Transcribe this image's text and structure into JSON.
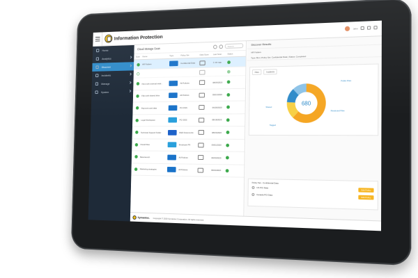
{
  "app": {
    "title": "Information Protection",
    "user_label": "John"
  },
  "sidebar": {
    "items": [
      {
        "label": "Home",
        "active": false,
        "chevron": false
      },
      {
        "label": "Analytics",
        "active": false,
        "chevron": true
      },
      {
        "label": "Discover",
        "active": true,
        "chevron": true
      },
      {
        "label": "Incidents",
        "active": false,
        "chevron": true
      },
      {
        "label": "Manage",
        "active": false,
        "chevron": true
      },
      {
        "label": "System",
        "active": false,
        "chevron": true
      }
    ]
  },
  "main": {
    "header": "Cloud Storage Scan",
    "search_placeholder": "Search",
    "columns": [
      "Scan",
      "Name",
      "Type",
      "Policy Set",
      "Data Scan",
      "Last Scan",
      "Status"
    ],
    "rows": [
      {
        "state": "selected",
        "scan": "full",
        "name": "HR Folders",
        "type": "box",
        "type_color": "#1a73c9",
        "policy": "Confidential Data",
        "last": "1 min ago"
      },
      {
        "state": "faded",
        "scan": "empty",
        "name": "",
        "type": "",
        "type_color": "#ffffff",
        "policy": "",
        "last": ""
      },
      {
        "state": "normal",
        "scan": "full",
        "name": "Files with external relati...",
        "type": "box",
        "type_color": "#1a73c9",
        "policy": "All Policies",
        "last": "08/05/2020"
      },
      {
        "state": "normal",
        "scan": "full",
        "name": "Files with shared links",
        "type": "box",
        "type_color": "#1a73c9",
        "policy": "All Policies",
        "last": "09/01/2020"
      },
      {
        "state": "normal",
        "scan": "full",
        "name": "Payment card data",
        "type": "box",
        "type_color": "#1a73c9",
        "policy": "PCI DSS",
        "last": "06/29/2020"
      },
      {
        "state": "normal",
        "scan": "full",
        "name": "Legal Workspace",
        "type": "sf",
        "type_color": "#2aa0dc",
        "policy": "PCI DSS",
        "last": "08/18/2020"
      },
      {
        "state": "normal",
        "scan": "full",
        "name": "Technical Support Folder",
        "type": "db",
        "type_color": "#1e62c9",
        "policy": "R&D Documents",
        "last": "08/03/2020"
      },
      {
        "state": "normal",
        "scan": "full",
        "name": "Fiscal Files",
        "type": "sf",
        "type_color": "#2aa0dc",
        "policy": "Employee PII",
        "last": "09/01/2020"
      },
      {
        "state": "normal",
        "scan": "full",
        "name": "Beta launch",
        "type": "box",
        "type_color": "#1a73c9",
        "policy": "All Policies",
        "last": "09/03/2020"
      },
      {
        "state": "normal",
        "scan": "full",
        "name": "Marketing strategies",
        "type": "box",
        "type_color": "#1a73c9",
        "policy": "All Policies",
        "last": "09/02/2020"
      }
    ]
  },
  "right": {
    "header": "Discover Results",
    "source": "HR Folders",
    "meta": "Type: Box | Policy Set: Confidential Data | Status: Completed",
    "tabs": [
      "Files",
      "Incidents"
    ],
    "donut": {
      "total": "680",
      "segments": [
        {
          "label": "Restricted Files",
          "value": 0.62,
          "color": "#f5a623"
        },
        {
          "label": "Public Files",
          "value": 0.14,
          "color": "#f7d046"
        },
        {
          "label": "Shared",
          "value": 0.12,
          "color": "#2f8bc9"
        },
        {
          "label": "Tagged",
          "value": 0.12,
          "color": "#8dc3e8"
        }
      ]
    },
    "policy_section": "Policy Set - Confidential Data",
    "policy_options": [
      {
        "label": "US PCI Data",
        "button": "Edit Policy"
      },
      {
        "label": "Canada PCI Data",
        "button": "Edit Policy"
      }
    ]
  },
  "footer": {
    "brand": "Symantec.",
    "copyright": "Copyright © 2020 Symantec Corporation. All rights reserved."
  }
}
